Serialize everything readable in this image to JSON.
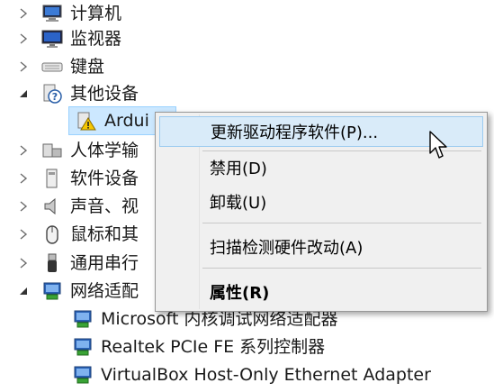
{
  "tree": {
    "items": [
      {
        "label": "计算机",
        "icon": "computer-icon",
        "expanded": false
      },
      {
        "label": "监视器",
        "icon": "monitor-icon",
        "expanded": false
      },
      {
        "label": "键盘",
        "icon": "keyboard-icon",
        "expanded": false
      },
      {
        "label": "其他设备",
        "icon": "unknown-device-icon",
        "expanded": true
      },
      {
        "label": "Ardui",
        "icon": "warning-device-icon",
        "selected": true
      },
      {
        "label": "人体学输",
        "icon": "hid-icon",
        "expanded": false
      },
      {
        "label": "软件设备",
        "icon": "software-device-icon",
        "expanded": false
      },
      {
        "label": "声音、视",
        "icon": "speaker-icon",
        "expanded": false
      },
      {
        "label": "鼠标和其",
        "icon": "mouse-icon",
        "expanded": false
      },
      {
        "label": "通用串行",
        "icon": "usb-icon",
        "expanded": false
      },
      {
        "label": "网络适配",
        "icon": "network-adapter-icon",
        "expanded": true
      },
      {
        "label": "Microsoft 内核调试网络适配器",
        "icon": "network-adapter-icon"
      },
      {
        "label": "Realtek PCIe FE 系列控制器",
        "icon": "network-adapter-icon"
      },
      {
        "label": "VirtualBox Host-Only Ethernet Adapter",
        "icon": "network-adapter-icon"
      }
    ]
  },
  "context_menu": {
    "update_driver": "更新驱动程序软件(P)...",
    "disable": "禁用(D)",
    "uninstall": "卸载(U)",
    "scan": "扫描检测硬件改动(A)",
    "properties": "属性(R)"
  },
  "colors": {
    "selection_bg": "#cce8ff",
    "menu_bg": "#f0f0f0",
    "menu_hover": "#d9ebf9"
  }
}
